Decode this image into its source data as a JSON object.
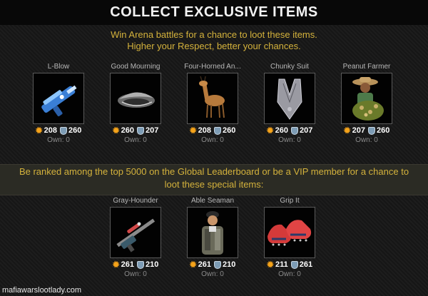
{
  "header": {
    "title": "COLLECT EXCLUSIVE ITEMS"
  },
  "intro": {
    "line1": "Win Arena battles for a chance to loot these items.",
    "line2": "Higher your Respect, better your chances."
  },
  "arena_items": [
    {
      "name": "L-Blow",
      "attack": "208",
      "defense": "260",
      "own": "Own: 0",
      "icon": "futuristic-gun-icon"
    },
    {
      "name": "Good Mourning",
      "attack": "260",
      "defense": "207",
      "own": "Own: 0",
      "icon": "metal-vehicle-icon"
    },
    {
      "name": "Four-Horned An...",
      "attack": "208",
      "defense": "260",
      "own": "Own: 0",
      "icon": "antelope-icon"
    },
    {
      "name": "Chunky Suit",
      "attack": "260",
      "defense": "207",
      "own": "Own: 0",
      "icon": "chain-vest-icon"
    },
    {
      "name": "Peanut Farmer",
      "attack": "207",
      "defense": "260",
      "own": "Own: 0",
      "icon": "farmer-icon"
    }
  ],
  "leaderboard": {
    "line1": "Be ranked among the top 5000 on the Global Leaderboard or be a VIP member for a chance to",
    "line2": "loot these special items:"
  },
  "special_items": [
    {
      "name": "Gray-Hounder",
      "attack": "261",
      "defense": "210",
      "own": "Own: 0",
      "icon": "sniper-rifle-icon"
    },
    {
      "name": "Able Seaman",
      "attack": "261",
      "defense": "210",
      "own": "Own: 0",
      "icon": "seaman-icon"
    },
    {
      "name": "Grip It",
      "attack": "211",
      "defense": "261",
      "own": "Own: 0",
      "icon": "cleats-icon"
    }
  ],
  "watermark": "mafiawarslootlady.com",
  "colors": {
    "gold": "#d4b23c",
    "attack": "#f5a31a",
    "defense": "#7d9cb5"
  }
}
